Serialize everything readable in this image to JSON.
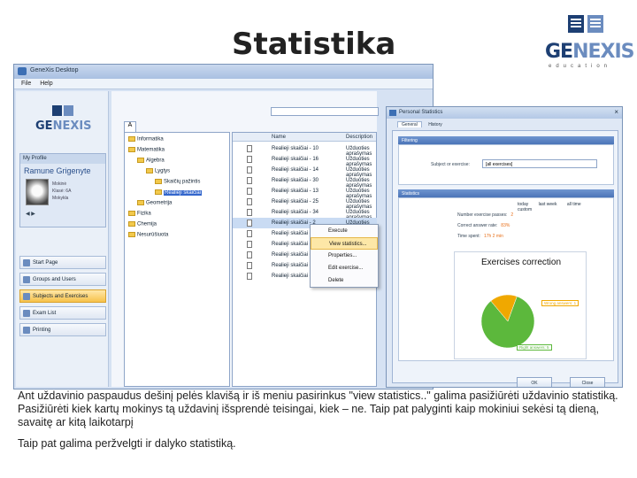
{
  "slide": {
    "title": "Statistika"
  },
  "logo": {
    "word_ge": "GE",
    "word_nexis": "NEXIS",
    "sub": "education"
  },
  "app": {
    "window_title": "GeneXis Desktop",
    "menu": [
      "File",
      "Help"
    ],
    "left_logo_ge": "GE",
    "left_logo_nexis": "NEXIS",
    "profile_header": "My Profile",
    "profile_name": "Ramune Grigenyte",
    "profile_info": [
      "Mokinė",
      "Klasė: 6A",
      "Mokykla"
    ],
    "nav_items": [
      {
        "label": "Start Page",
        "active": false
      },
      {
        "label": "Groups and Users",
        "active": false
      },
      {
        "label": "Subjects and Exercises",
        "active": true
      },
      {
        "label": "Exam List",
        "active": false
      },
      {
        "label": "Printing",
        "active": false
      }
    ],
    "tab_label": "A",
    "tree": [
      {
        "label": "Informatika",
        "indent": 0
      },
      {
        "label": "Matematika",
        "indent": 0
      },
      {
        "label": "Algebra",
        "indent": 1
      },
      {
        "label": "Lygtys",
        "indent": 2
      },
      {
        "label": "Skaičių pažintis",
        "indent": 3
      },
      {
        "label": "Realieji skaičiai",
        "indent": 3,
        "selected": true
      },
      {
        "label": "Geometrija",
        "indent": 1
      },
      {
        "label": "Fizika",
        "indent": 0
      },
      {
        "label": "Chemija",
        "indent": 0
      },
      {
        "label": "Nesurūšiuota",
        "indent": 0
      }
    ],
    "list_headers": [
      "Name",
      "Description"
    ],
    "list_rows": [
      {
        "name": "Realieji skaičiai - 10",
        "desc": "Užduoties aprašymas"
      },
      {
        "name": "Realieji skaičiai - 16",
        "desc": "Užduoties aprašymas"
      },
      {
        "name": "Realieji skaičiai - 14",
        "desc": "Užduoties aprašymas"
      },
      {
        "name": "Realieji skaičiai - 30",
        "desc": "Užduoties aprašymas"
      },
      {
        "name": "Realieji skaičiai - 13",
        "desc": "Užduoties aprašymas"
      },
      {
        "name": "Realieji skaičiai - 25",
        "desc": "Užduoties aprašymas"
      },
      {
        "name": "Realieji skaičiai - 34",
        "desc": "Užduoties aprašymas"
      },
      {
        "name": "Realieji skaičiai - 2",
        "desc": "Užduoties aprašymas",
        "highlight": true
      },
      {
        "name": "Realieji skaičiai - 7",
        "desc": ""
      },
      {
        "name": "Realieji skaičiai - 9",
        "desc": ""
      },
      {
        "name": "Realieji skaičiai - 11",
        "desc": ""
      },
      {
        "name": "Realieji skaičiai - 12",
        "desc": ""
      },
      {
        "name": "Realieji skaičiai - 17",
        "desc": ""
      }
    ],
    "context_menu": [
      {
        "label": "Execute",
        "hot": false
      },
      {
        "label": "View statistics...",
        "hot": true
      },
      {
        "label": "Properties...",
        "hot": false
      },
      {
        "label": "Edit exercise...",
        "hot": false
      },
      {
        "label": "Delete",
        "hot": false
      }
    ]
  },
  "dialog": {
    "title": "Personal Statistics",
    "tabs": [
      "General",
      "History"
    ],
    "filter_header": "Filtering",
    "filter_label": "Subject or exercise:",
    "filter_value": "[all exercises]",
    "stats_header": "Statistics",
    "periods": [
      "today",
      "last week",
      "all time",
      "custom"
    ],
    "stats": [
      {
        "label": "Number exercise passes:",
        "value": "2"
      },
      {
        "label": "Correct answer rate:",
        "value": "83%"
      },
      {
        "label": "Time spent:",
        "value": "17h 2 min"
      }
    ],
    "buttons": [
      "OK",
      "Close"
    ]
  },
  "chart_data": {
    "type": "pie",
    "title": "Exercises correction",
    "slices": [
      {
        "label": "Right answers: 5",
        "value": 5,
        "color": "#5cb83c"
      },
      {
        "label": "Wrong answers: 1",
        "value": 1,
        "color": "#f0a800"
      }
    ]
  },
  "caption": {
    "p1": "Ant uždavinio paspaudus dešinį pelės klavišą ir iš meniu pasirinkus \"view statistics..\" galima pasižiūrėti uždavinio statistiką. Pasižiūrėti kiek kartų mokinys tą uždavinį išsprendė teisingai, kiek – ne. Taip pat palyginti kaip mokiniui sekėsi tą dieną, savaitę ar kitą laikotarpį",
    "p2": "Taip pat galima peržvelgti ir dalyko statistiką."
  }
}
